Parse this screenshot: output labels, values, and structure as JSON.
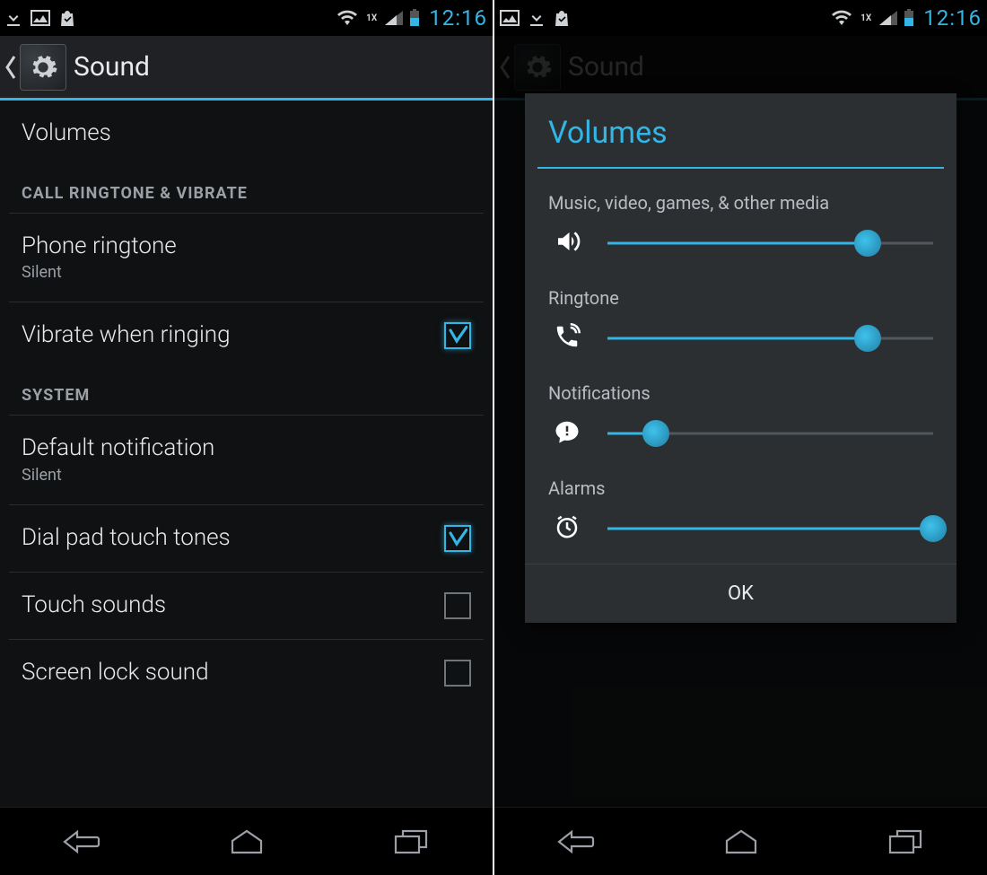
{
  "statusbar": {
    "time": "12:16",
    "network_type": "1X"
  },
  "screen1": {
    "title": "Sound",
    "items": {
      "volumes": {
        "label": "Volumes"
      },
      "sec_ringtone": "CALL RINGTONE & VIBRATE",
      "phone_ringtone": {
        "label": "Phone ringtone",
        "value": "Silent"
      },
      "vibrate": {
        "label": "Vibrate when ringing",
        "checked": true
      },
      "sec_system": "SYSTEM",
      "default_notif": {
        "label": "Default notification",
        "value": "Silent"
      },
      "dialpad": {
        "label": "Dial pad touch tones",
        "checked": true
      },
      "touch_sounds": {
        "label": "Touch sounds",
        "checked": false
      },
      "screen_lock": {
        "label": "Screen lock sound",
        "checked": false
      }
    }
  },
  "screen2": {
    "title": "Sound",
    "dialog": {
      "title": "Volumes",
      "ok": "OK",
      "sliders": [
        {
          "label": "Music, video, games, & other media",
          "icon": "speaker",
          "value": 80
        },
        {
          "label": "Ringtone",
          "icon": "phone-ring",
          "value": 80
        },
        {
          "label": "Notifications",
          "icon": "chat-alert",
          "value": 15
        },
        {
          "label": "Alarms",
          "icon": "alarm",
          "value": 100
        }
      ]
    }
  },
  "colors": {
    "accent": "#33b5e5"
  }
}
